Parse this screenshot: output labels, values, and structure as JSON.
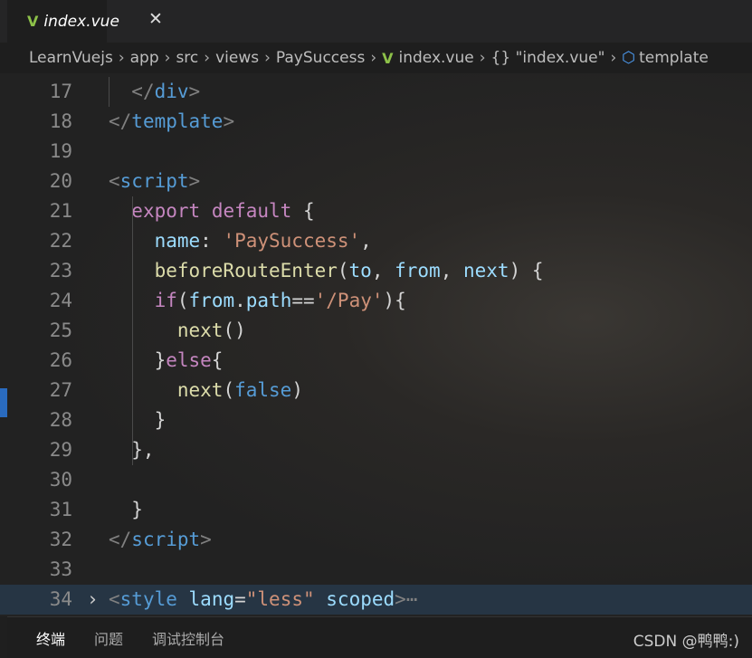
{
  "tab": {
    "icon": "vue-icon",
    "title": "index.vue",
    "close": "✕"
  },
  "breadcrumb": [
    "LearnVuejs",
    "app",
    "src",
    "views",
    "PaySuccess",
    "index.vue",
    "{} \"index.vue\"",
    "template"
  ],
  "editor": {
    "lines": [
      {
        "n": "17",
        "t": [
          [
            "  ",
            "plain"
          ],
          [
            "</",
            "punc"
          ],
          [
            "div",
            "tag"
          ],
          [
            ">",
            "punc"
          ]
        ]
      },
      {
        "n": "18",
        "t": [
          [
            "</",
            "punc"
          ],
          [
            "template",
            "tag"
          ],
          [
            ">",
            "punc"
          ]
        ]
      },
      {
        "n": "19",
        "t": []
      },
      {
        "n": "20",
        "t": [
          [
            "<",
            "punc"
          ],
          [
            "script",
            "tag"
          ],
          [
            ">",
            "punc"
          ]
        ]
      },
      {
        "n": "21",
        "t": [
          [
            "  ",
            "plain"
          ],
          [
            "export",
            "kw"
          ],
          [
            " ",
            "plain"
          ],
          [
            "default",
            "kw"
          ],
          [
            " {",
            "plain"
          ]
        ]
      },
      {
        "n": "22",
        "t": [
          [
            "    ",
            "plain"
          ],
          [
            "name",
            "prop"
          ],
          [
            ": ",
            "plain"
          ],
          [
            "'PaySuccess'",
            "str"
          ],
          [
            ",",
            "plain"
          ]
        ]
      },
      {
        "n": "23",
        "t": [
          [
            "    ",
            "plain"
          ],
          [
            "beforeRouteEnter",
            "fn"
          ],
          [
            "(",
            "plain"
          ],
          [
            "to",
            "prop"
          ],
          [
            ", ",
            "plain"
          ],
          [
            "from",
            "prop"
          ],
          [
            ", ",
            "plain"
          ],
          [
            "next",
            "prop"
          ],
          [
            ") {",
            "plain"
          ]
        ]
      },
      {
        "n": "24",
        "t": [
          [
            "    ",
            "plain"
          ],
          [
            "if",
            "kw"
          ],
          [
            "(",
            "plain"
          ],
          [
            "from",
            "prop"
          ],
          [
            ".",
            "plain"
          ],
          [
            "path",
            "prop"
          ],
          [
            "==",
            "plain"
          ],
          [
            "'/Pay'",
            "str"
          ],
          [
            "){",
            "plain"
          ]
        ]
      },
      {
        "n": "25",
        "t": [
          [
            "      ",
            "plain"
          ],
          [
            "next",
            "fn"
          ],
          [
            "()",
            "plain"
          ]
        ]
      },
      {
        "n": "26",
        "t": [
          [
            "    }",
            "plain"
          ],
          [
            "else",
            "kw"
          ],
          [
            "{",
            "plain"
          ]
        ]
      },
      {
        "n": "27",
        "t": [
          [
            "      ",
            "plain"
          ],
          [
            "next",
            "fn"
          ],
          [
            "(",
            "plain"
          ],
          [
            "false",
            "bool"
          ],
          [
            ")",
            "plain"
          ]
        ]
      },
      {
        "n": "28",
        "t": [
          [
            "    }",
            "plain"
          ]
        ]
      },
      {
        "n": "29",
        "t": [
          [
            "  },",
            "plain"
          ]
        ]
      },
      {
        "n": "30",
        "t": []
      },
      {
        "n": "31",
        "t": [
          [
            "  }",
            "plain"
          ]
        ]
      },
      {
        "n": "32",
        "t": [
          [
            "</",
            "punc"
          ],
          [
            "script",
            "tag"
          ],
          [
            ">",
            "punc"
          ]
        ]
      },
      {
        "n": "33",
        "t": []
      },
      {
        "n": "34",
        "fold": true,
        "t": [
          [
            "<",
            "punc"
          ],
          [
            "style",
            "tag"
          ],
          [
            " ",
            "plain"
          ],
          [
            "lang",
            "attr"
          ],
          [
            "=",
            "plain"
          ],
          [
            "\"less\"",
            "str"
          ],
          [
            " ",
            "plain"
          ],
          [
            "scoped",
            "attr"
          ],
          [
            ">",
            "punc"
          ],
          [
            "⋯",
            "punc"
          ]
        ]
      }
    ]
  },
  "panel": {
    "tabs": [
      "终端",
      "问题",
      "调试控制台"
    ],
    "watermark": "CSDN @鸭鸭:)"
  }
}
